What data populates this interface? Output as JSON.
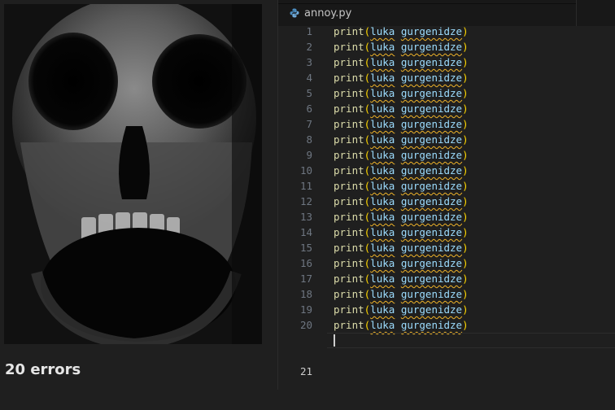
{
  "meme": {
    "caption": "20 errors"
  },
  "editor": {
    "tab": {
      "filename": "annoy.py",
      "icon": "python-icon"
    },
    "lines": [
      {
        "number": "1",
        "fn": "print",
        "open": "(",
        "arg1": "luka",
        "space": " ",
        "arg2": "gurgenidze",
        "close": ")"
      },
      {
        "number": "2",
        "fn": "print",
        "open": "(",
        "arg1": "luka",
        "space": " ",
        "arg2": "gurgenidze",
        "close": ")"
      },
      {
        "number": "3",
        "fn": "print",
        "open": "(",
        "arg1": "luka",
        "space": " ",
        "arg2": "gurgenidze",
        "close": ")"
      },
      {
        "number": "4",
        "fn": "print",
        "open": "(",
        "arg1": "luka",
        "space": " ",
        "arg2": "gurgenidze",
        "close": ")"
      },
      {
        "number": "5",
        "fn": "print",
        "open": "(",
        "arg1": "luka",
        "space": " ",
        "arg2": "gurgenidze",
        "close": ")"
      },
      {
        "number": "6",
        "fn": "print",
        "open": "(",
        "arg1": "luka",
        "space": " ",
        "arg2": "gurgenidze",
        "close": ")"
      },
      {
        "number": "7",
        "fn": "print",
        "open": "(",
        "arg1": "luka",
        "space": " ",
        "arg2": "gurgenidze",
        "close": ")"
      },
      {
        "number": "8",
        "fn": "print",
        "open": "(",
        "arg1": "luka",
        "space": " ",
        "arg2": "gurgenidze",
        "close": ")"
      },
      {
        "number": "9",
        "fn": "print",
        "open": "(",
        "arg1": "luka",
        "space": " ",
        "arg2": "gurgenidze",
        "close": ")"
      },
      {
        "number": "10",
        "fn": "print",
        "open": "(",
        "arg1": "luka",
        "space": " ",
        "arg2": "gurgenidze",
        "close": ")"
      },
      {
        "number": "11",
        "fn": "print",
        "open": "(",
        "arg1": "luka",
        "space": " ",
        "arg2": "gurgenidze",
        "close": ")"
      },
      {
        "number": "12",
        "fn": "print",
        "open": "(",
        "arg1": "luka",
        "space": " ",
        "arg2": "gurgenidze",
        "close": ")"
      },
      {
        "number": "13",
        "fn": "print",
        "open": "(",
        "arg1": "luka",
        "space": " ",
        "arg2": "gurgenidze",
        "close": ")"
      },
      {
        "number": "14",
        "fn": "print",
        "open": "(",
        "arg1": "luka",
        "space": " ",
        "arg2": "gurgenidze",
        "close": ")"
      },
      {
        "number": "15",
        "fn": "print",
        "open": "(",
        "arg1": "luka",
        "space": " ",
        "arg2": "gurgenidze",
        "close": ")"
      },
      {
        "number": "16",
        "fn": "print",
        "open": "(",
        "arg1": "luka",
        "space": " ",
        "arg2": "gurgenidze",
        "close": ")"
      },
      {
        "number": "17",
        "fn": "print",
        "open": "(",
        "arg1": "luka",
        "space": " ",
        "arg2": "gurgenidze",
        "close": ")"
      },
      {
        "number": "18",
        "fn": "print",
        "open": "(",
        "arg1": "luka",
        "space": " ",
        "arg2": "gurgenidze",
        "close": ")"
      },
      {
        "number": "19",
        "fn": "print",
        "open": "(",
        "arg1": "luka",
        "space": " ",
        "arg2": "gurgenidze",
        "close": ")"
      },
      {
        "number": "20",
        "fn": "print",
        "open": "(",
        "arg1": "luka",
        "space": " ",
        "arg2": "gurgenidze",
        "close": ")"
      }
    ],
    "current_line": {
      "number": "21"
    }
  },
  "colors": {
    "editor_bg": "#1f1f1f",
    "function": "#dcdcaa",
    "bracket": "#ffd700",
    "variable": "#9cdcfe",
    "squiggle": "#f0b429"
  }
}
